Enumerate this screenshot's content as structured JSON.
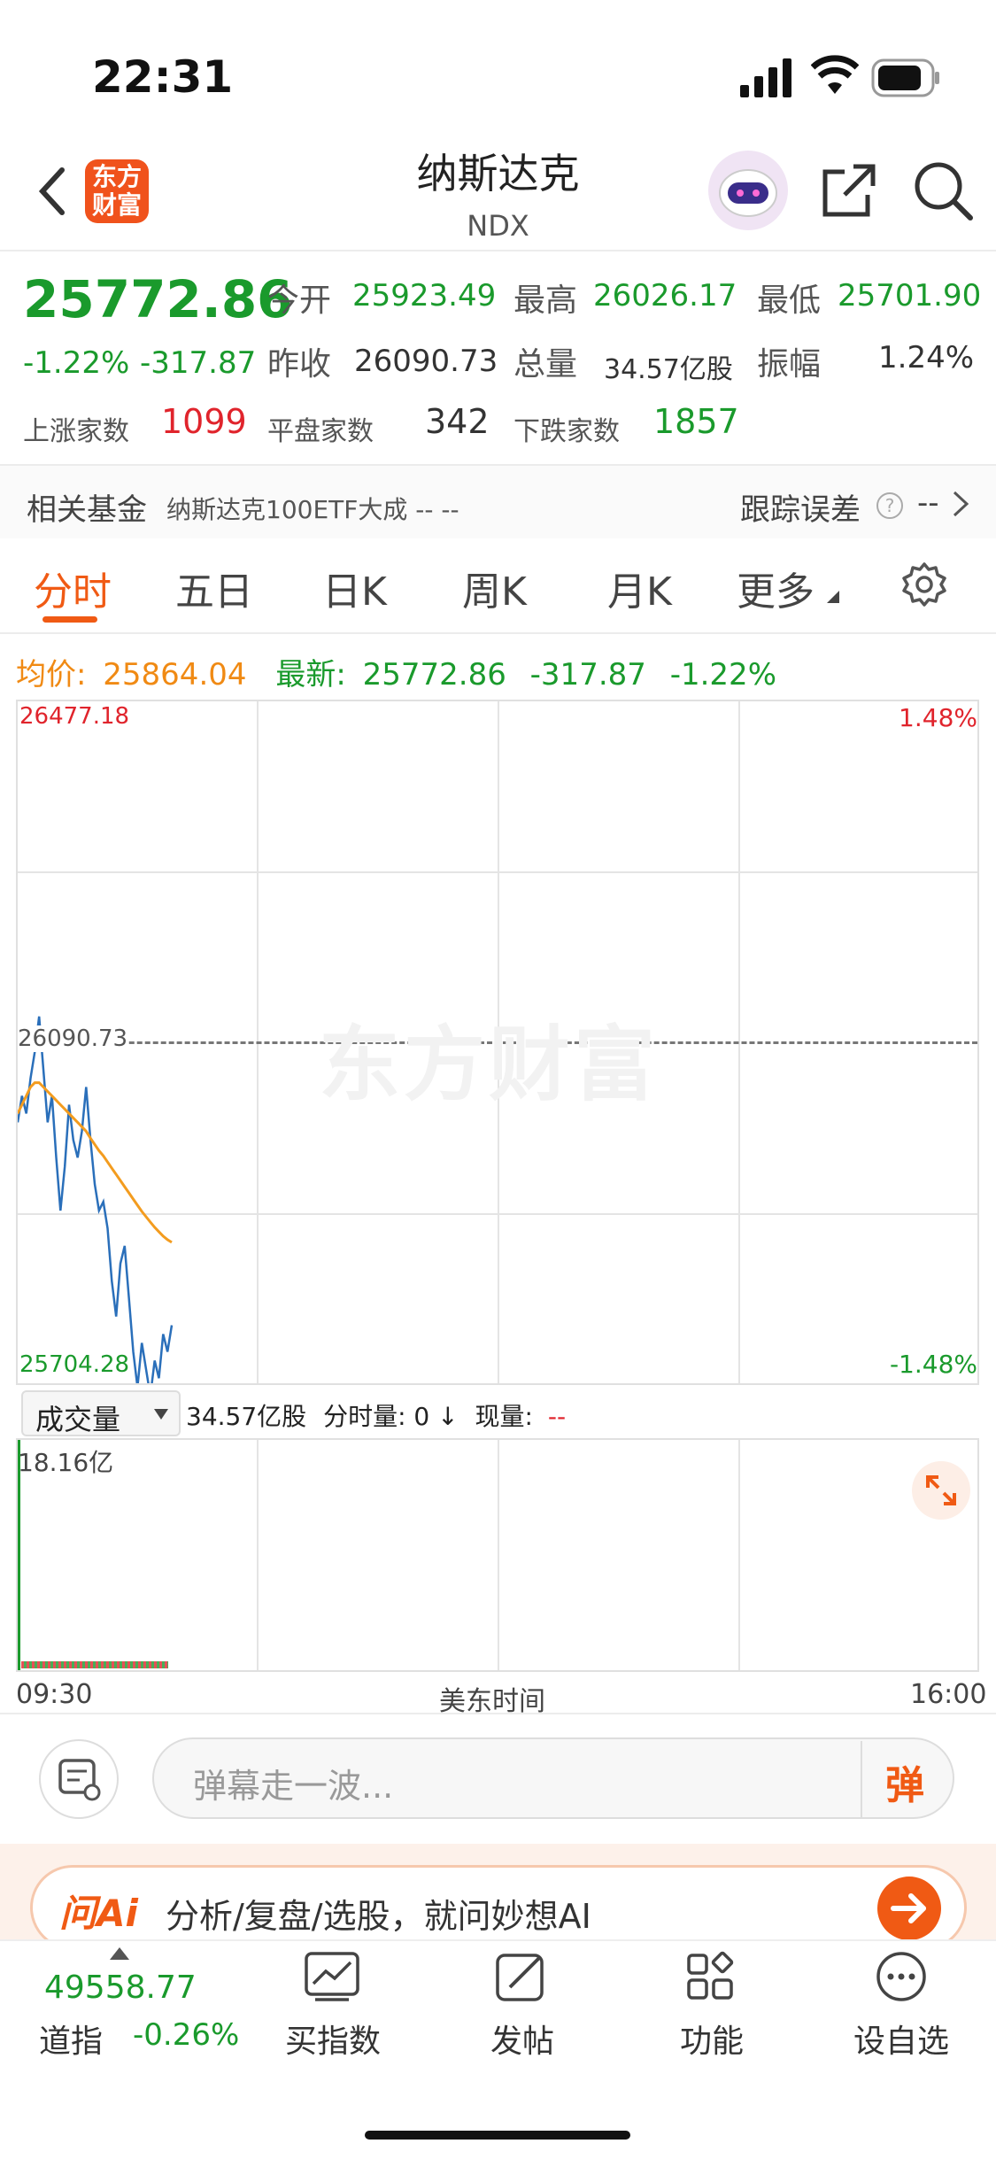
{
  "status": {
    "time": "22:31"
  },
  "nav": {
    "title": "纳斯达克",
    "subtitle": "NDX",
    "logo_text_1": "东方",
    "logo_text_2": "财富"
  },
  "quote": {
    "price": "25772.86",
    "change_pct": "-1.22%",
    "change": "-317.87",
    "open_label": "今开",
    "open": "25923.49",
    "high_label": "最高",
    "high": "26026.17",
    "low_label": "最低",
    "low": "25701.90",
    "prev_close_label": "昨收",
    "prev_close": "26090.73",
    "volume_label": "总量",
    "volume": "34.57亿股",
    "amplitude_label": "振幅",
    "amplitude": "1.24%",
    "up_label": "上涨家数",
    "up": "1099",
    "flat_label": "平盘家数",
    "flat": "342",
    "down_label": "下跌家数",
    "down": "1857"
  },
  "fund": {
    "label": "相关基金",
    "name": "纳斯达克100ETF大成 -- --",
    "tracking_label": "跟踪误差",
    "tracking_value": "--"
  },
  "tabs": [
    "分时",
    "五日",
    "日K",
    "周K",
    "月K",
    "更多"
  ],
  "info_line": {
    "avg_label": "均价:",
    "avg": "25864.04",
    "last_label": "最新:",
    "last": "25772.86",
    "change": "-317.87",
    "pct": "-1.22%"
  },
  "chart_data": {
    "type": "line",
    "y_top": "26477.18",
    "y_mid": "26090.73",
    "y_bottom": "25704.28",
    "pct_top": "1.48%",
    "pct_bottom": "-1.48%",
    "ylim": [
      25704.28,
      26477.18
    ],
    "watermark": "东方财富",
    "series": [
      {
        "color": "#2a6fba",
        "values": [
          26000,
          26030,
          26010,
          26050,
          26080,
          26120,
          26060,
          26000,
          26030,
          25960,
          25900,
          25950,
          26020,
          25980,
          25960,
          25990,
          26040,
          25980,
          25930,
          25900,
          25910,
          25880,
          25820,
          25780,
          25840,
          25860,
          25800,
          25740,
          25700,
          25750,
          25720,
          25690,
          25730,
          25710,
          25760,
          25740,
          25770
        ]
      },
      {
        "color": "#f39c1f",
        "values": [
          26010,
          26020,
          26030,
          26040,
          26045,
          26045,
          26040,
          26035,
          26030,
          26025,
          26020,
          26015,
          26010,
          26005,
          26000,
          25995,
          25990,
          25982,
          25975,
          25968,
          25962,
          25955,
          25948,
          25941,
          25934,
          25927,
          25920,
          25913,
          25906,
          25899,
          25893,
          25887,
          25881,
          25876,
          25871,
          25867,
          25864
        ]
      }
    ]
  },
  "volume": {
    "selector": "成交量",
    "total": "34.57亿股",
    "tick_label": "分时量: 0 ↓",
    "now_label": "现量:",
    "now_value": "--",
    "max_label": "18.16亿",
    "time_start": "09:30",
    "time_mid": "美东时间",
    "time_end": "16:00"
  },
  "comment": {
    "placeholder": "弹幕走一波...",
    "send_label": "弹"
  },
  "ai_banner": {
    "logo": "问Ai",
    "text": "分析/复盘/选股，就问妙想AI"
  },
  "bottom_nav": {
    "dow_value": "49558.77",
    "dow_label": "道指",
    "dow_change": "-0.26%",
    "items": [
      "买指数",
      "发帖",
      "功能",
      "设自选"
    ]
  }
}
